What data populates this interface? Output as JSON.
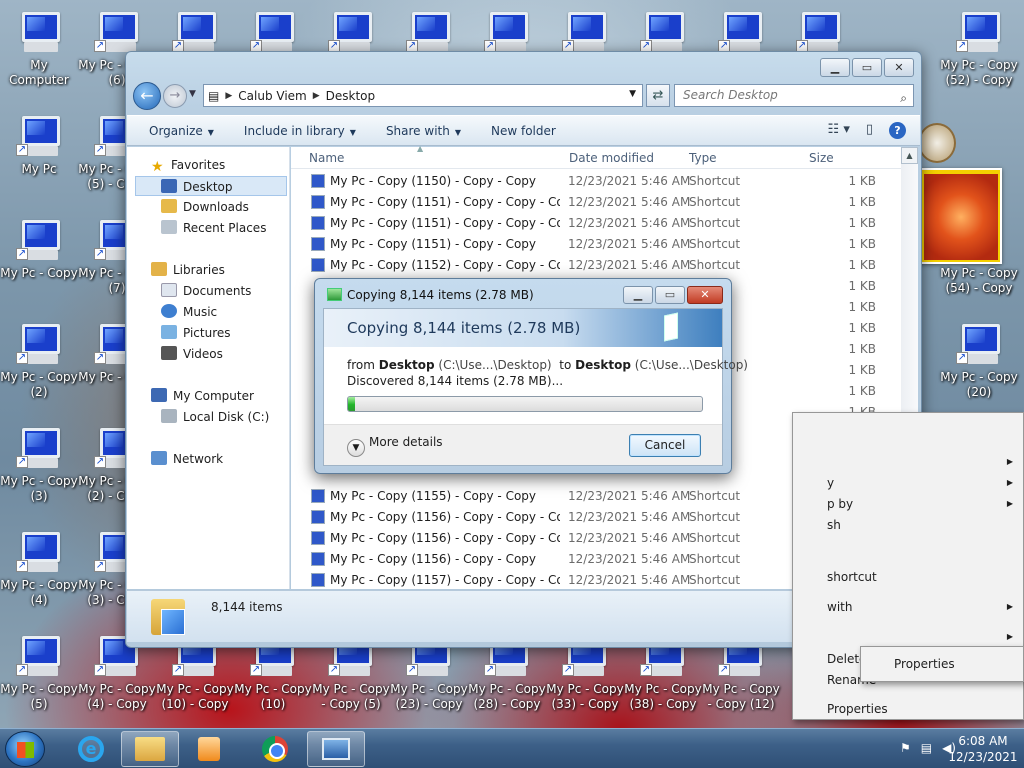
{
  "desktop": {
    "icons": [
      {
        "label": "My Computer",
        "shortcut": false
      },
      {
        "label": "My Pc - Copy (6)",
        "shortcut": true
      },
      {
        "label": "",
        "shortcut": true
      },
      {
        "label": "",
        "shortcut": true
      },
      {
        "label": "",
        "shortcut": true
      },
      {
        "label": "",
        "shortcut": true
      },
      {
        "label": "",
        "shortcut": true
      },
      {
        "label": "",
        "shortcut": true
      },
      {
        "label": "",
        "shortcut": true
      },
      {
        "label": "",
        "shortcut": true
      },
      {
        "label": "",
        "shortcut": true
      },
      {
        "label": "My Pc - Copy (52) - Copy",
        "shortcut": true
      },
      {
        "label": "My Pc",
        "shortcut": true
      },
      {
        "label": "My Pc - Copy (5) - Copy",
        "shortcut": true
      },
      {
        "label": "My Pc - Copy",
        "shortcut": true
      },
      {
        "label": "My Pc - Copy (7)",
        "shortcut": true
      },
      {
        "label": "My Pc - Copy (54) - Copy",
        "shortcut": true
      },
      {
        "label": "My Pc - Copy (2)",
        "shortcut": true
      },
      {
        "label": "My Pc - Copy",
        "shortcut": true
      },
      {
        "label": "My Pc - Copy (20)",
        "shortcut": true
      },
      {
        "label": "My Pc - Copy (3)",
        "shortcut": true
      },
      {
        "label": "My Pc - Copy (2) - Copy",
        "shortcut": true
      },
      {
        "label": "My Pc - Copy (4)",
        "shortcut": true
      },
      {
        "label": "My Pc - Copy (3) - Copy",
        "shortcut": true
      },
      {
        "label": "My Pc - Copy (5)",
        "shortcut": true
      },
      {
        "label": "My Pc - Copy (4) - Copy",
        "shortcut": true
      },
      {
        "label": "My Pc - Copy (10) - Copy",
        "shortcut": true
      },
      {
        "label": "My Pc - Copy (10)",
        "shortcut": true
      },
      {
        "label": "My Pc - Copy - Copy (5)",
        "shortcut": true
      },
      {
        "label": "My Pc - Copy (23) - Copy",
        "shortcut": true
      },
      {
        "label": "My Pc - Copy (28) - Copy",
        "shortcut": true
      },
      {
        "label": "My Pc - Copy (33) - Copy",
        "shortcut": true
      },
      {
        "label": "My Pc - Copy (38) - Copy",
        "shortcut": true
      },
      {
        "label": "My Pc - Copy - Copy (12)",
        "shortcut": true
      }
    ]
  },
  "explorer": {
    "breadcrumb": [
      "Calub Viem",
      "Desktop"
    ],
    "search_placeholder": "Search Desktop",
    "toolbar": {
      "organize": "Organize",
      "include_in_library": "Include in library",
      "share_with": "Share with",
      "new_folder": "New folder"
    },
    "nav": {
      "favorites": "Favorites",
      "desktop": "Desktop",
      "downloads": "Downloads",
      "recent_places": "Recent Places",
      "libraries": "Libraries",
      "documents": "Documents",
      "music": "Music",
      "pictures": "Pictures",
      "videos": "Videos",
      "my_computer": "My Computer",
      "local_disk": "Local Disk (C:)",
      "network": "Network"
    },
    "columns": {
      "name": "Name",
      "date": "Date modified",
      "type": "Type",
      "size": "Size"
    },
    "rows": [
      {
        "name": "My Pc - Copy (1150) - Copy - Copy",
        "date": "12/23/2021 5:46 AM",
        "type": "Shortcut",
        "size": "1 KB"
      },
      {
        "name": "My Pc - Copy (1151) - Copy - Copy - Co...",
        "date": "12/23/2021 5:46 AM",
        "type": "Shortcut",
        "size": "1 KB"
      },
      {
        "name": "My Pc - Copy (1151) - Copy - Copy - Copy",
        "date": "12/23/2021 5:46 AM",
        "type": "Shortcut",
        "size": "1 KB"
      },
      {
        "name": "My Pc - Copy (1151) - Copy - Copy",
        "date": "12/23/2021 5:46 AM",
        "type": "Shortcut",
        "size": "1 KB"
      },
      {
        "name": "My Pc - Copy (1152) - Copy - Copy - Co...",
        "date": "12/23/2021 5:46 AM",
        "type": "Shortcut",
        "size": "1 KB"
      },
      {
        "name": "",
        "date": "",
        "type": "",
        "size": "1 KB"
      },
      {
        "name": "",
        "date": "",
        "type": "",
        "size": "1 KB"
      },
      {
        "name": "",
        "date": "",
        "type": "",
        "size": "1 KB"
      },
      {
        "name": "",
        "date": "",
        "type": "",
        "size": "1 KB"
      },
      {
        "name": "",
        "date": "",
        "type": "",
        "size": "1 KB"
      },
      {
        "name": "",
        "date": "",
        "type": "",
        "size": "1 KB"
      },
      {
        "name": "",
        "date": "",
        "type": "",
        "size": "1 KB"
      },
      {
        "name": "",
        "date": "",
        "type": "",
        "size": "1 KB"
      },
      {
        "name": "",
        "date": "",
        "type": "",
        "size": "1 KB"
      },
      {
        "name": "",
        "date": "",
        "type": "",
        "size": "1 KB"
      },
      {
        "name": "My Pc - Copy (1155) - Copy - Copy",
        "date": "12/23/2021 5:46 AM",
        "type": "Shortcut",
        "size": "1 KB"
      },
      {
        "name": "My Pc - Copy (1156) - Copy - Copy - Co...",
        "date": "12/23/2021 5:46 AM",
        "type": "Shortcut",
        "size": "1 KB"
      },
      {
        "name": "My Pc - Copy (1156) - Copy - Copy - Copy",
        "date": "12/23/2021 5:46 AM",
        "type": "Shortcut",
        "size": "1 KB"
      },
      {
        "name": "My Pc - Copy (1156) - Copy - Copy",
        "date": "12/23/2021 5:46 AM",
        "type": "Shortcut",
        "size": "1 KB"
      },
      {
        "name": "My Pc - Copy (1157) - Copy - Copy - Co...",
        "date": "12/23/2021 5:46 AM",
        "type": "Shortcut",
        "size": "1 KB"
      }
    ],
    "details_count": "8,144 items"
  },
  "copy_dialog": {
    "title": "Copying 8,144 items (2.78 MB)",
    "heading": "Copying 8,144 items (2.78 MB)",
    "from_word": "from",
    "from_name": "Desktop",
    "from_path": "(C:\\Use...\\Desktop)",
    "to_word": "to",
    "to_name": "Desktop",
    "to_path": "(C:\\Use...\\Desktop)",
    "discovered": "Discovered 8,144 items (2.78 MB)...",
    "progress": 0.02,
    "more_details": "More details",
    "cancel": "Cancel"
  },
  "context_menu": {
    "items": [
      {
        "label": "",
        "arrow": false
      },
      {
        "label": "",
        "arrow": true
      },
      {
        "label": "y",
        "arrow": true
      },
      {
        "label": "p by",
        "arrow": true
      },
      {
        "label": "sh",
        "arrow": false
      },
      {
        "label": "shortcut",
        "arrow": false
      },
      {
        "label": "with",
        "arrow": true
      },
      {
        "label": "",
        "arrow": true
      },
      {
        "label": "Delete",
        "arrow": false
      },
      {
        "label": "Rename",
        "arrow": false
      },
      {
        "label": "Properties",
        "arrow": false
      }
    ],
    "submenu_item": "Properties"
  },
  "taskbar": {
    "clock_time": "6:08 AM",
    "clock_date": "12/23/2021"
  }
}
